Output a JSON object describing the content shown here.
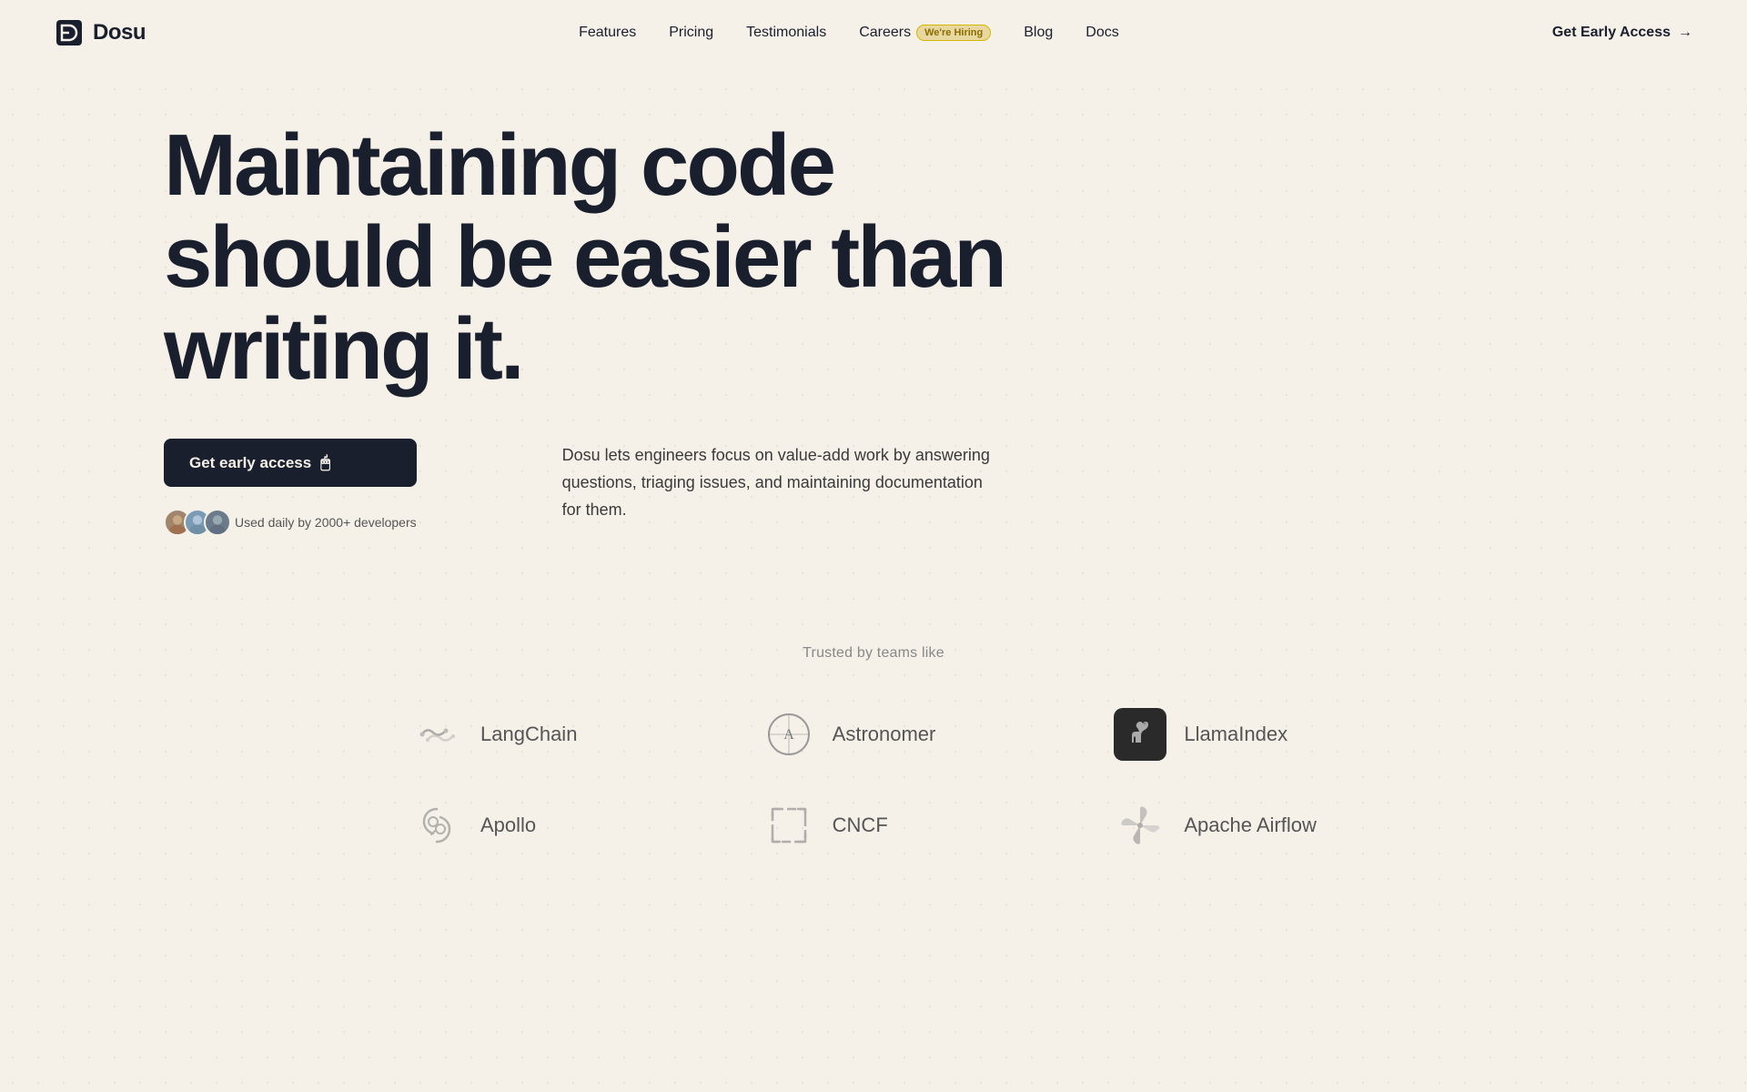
{
  "brand": {
    "name": "Dosu",
    "logo_alt": "Dosu logo"
  },
  "nav": {
    "links": [
      {
        "label": "Features",
        "href": "#"
      },
      {
        "label": "Pricing",
        "href": "#"
      },
      {
        "label": "Testimonials",
        "href": "#"
      },
      {
        "label": "Careers",
        "href": "#",
        "badge": "We're Hiring"
      },
      {
        "label": "Blog",
        "href": "#"
      },
      {
        "label": "Docs",
        "href": "#"
      }
    ],
    "cta_label": "Get Early Access",
    "cta_arrow": "→"
  },
  "hero": {
    "headline": "Maintaining code should be easier than writing it.",
    "cta_label": "Get early access",
    "social_proof_text": "Used daily by 2000+ developers",
    "description": "Dosu lets engineers focus on value-add work by answering questions, triaging issues, and maintaining documentation for them."
  },
  "trusted": {
    "label": "Trusted by teams like",
    "companies": [
      {
        "name": "LangChain",
        "icon_type": "langchain"
      },
      {
        "name": "Astronomer",
        "icon_type": "astronomer"
      },
      {
        "name": "LlamaIndex",
        "icon_type": "llamaindex"
      },
      {
        "name": "Apollo",
        "icon_type": "apollo"
      },
      {
        "name": "CNCF",
        "icon_type": "cncf"
      },
      {
        "name": "Apache Airflow",
        "icon_type": "airflow"
      }
    ]
  }
}
